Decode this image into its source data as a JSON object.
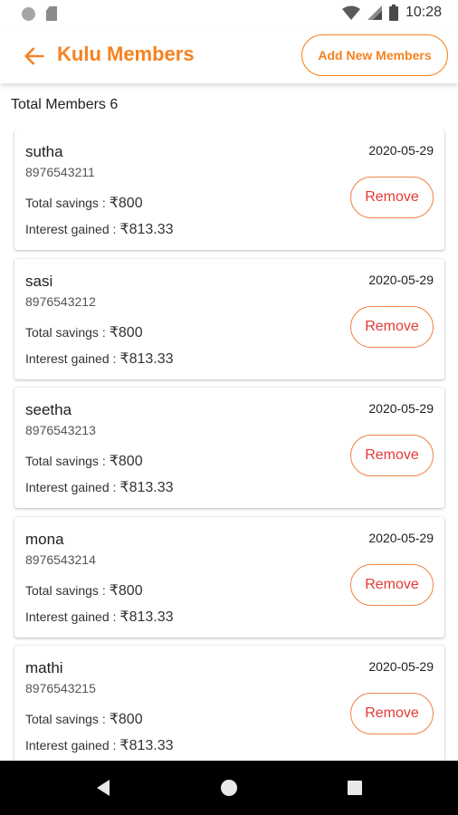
{
  "status_bar": {
    "time": "10:28",
    "icons": [
      "notification-dot-icon",
      "sd-card-icon",
      "wifi-icon",
      "signal-icon",
      "battery-icon"
    ]
  },
  "app_bar": {
    "back_icon": "arrow-left-icon",
    "title": "Kulu Members",
    "add_button_label": "Add New Members"
  },
  "summary": {
    "total_members": "Total Members 6"
  },
  "labels": {
    "savings": "Total savings :",
    "interest": "Interest gained :",
    "remove": "Remove"
  },
  "members": [
    {
      "name": "sutha",
      "phone": "8976543211",
      "date": "2020-05-29",
      "savings": "₹800",
      "interest": "₹813.33"
    },
    {
      "name": "sasi",
      "phone": "8976543212",
      "date": "2020-05-29",
      "savings": "₹800",
      "interest": "₹813.33"
    },
    {
      "name": "seetha",
      "phone": "8976543213",
      "date": "2020-05-29",
      "savings": "₹800",
      "interest": "₹813.33"
    },
    {
      "name": "mona",
      "phone": "8976543214",
      "date": "2020-05-29",
      "savings": "₹800",
      "interest": "₹813.33"
    },
    {
      "name": "mathi",
      "phone": "8976543215",
      "date": "2020-05-29",
      "savings": "₹800",
      "interest": "₹813.33"
    }
  ],
  "colors": {
    "accent": "#f58220",
    "remove_text": "#e53935",
    "nav_bar": "#000000"
  },
  "nav": {
    "icons": [
      "nav-back-icon",
      "nav-home-icon",
      "nav-recent-icon"
    ]
  }
}
